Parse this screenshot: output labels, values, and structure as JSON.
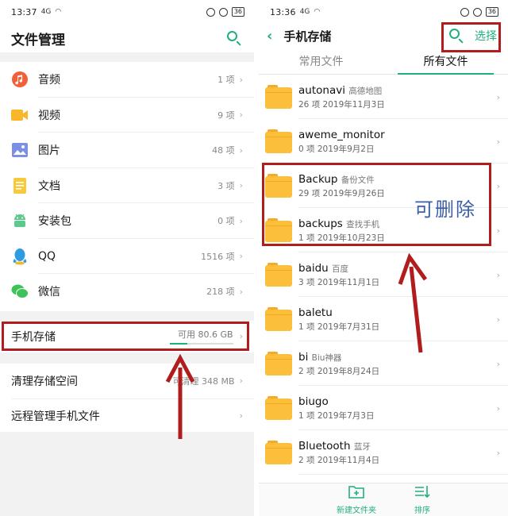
{
  "left": {
    "status": {
      "time": "13:37",
      "signal": "4G",
      "battery": "36"
    },
    "title": "文件管理",
    "categories": [
      {
        "label": "音频",
        "count": "1 项",
        "icon": "music-icon",
        "color": "#f2603a"
      },
      {
        "label": "视频",
        "count": "9 项",
        "icon": "video-icon",
        "color": "#f8b62a"
      },
      {
        "label": "图片",
        "count": "48 项",
        "icon": "image-icon",
        "color": "#7c8fe6"
      },
      {
        "label": "文档",
        "count": "3 项",
        "icon": "document-icon",
        "color": "#f9c93a"
      },
      {
        "label": "安装包",
        "count": "0 项",
        "icon": "android-icon",
        "color": "#5fc98b"
      },
      {
        "label": "QQ",
        "count": "1516 项",
        "icon": "qq-icon",
        "color": "#2f9be0"
      },
      {
        "label": "微信",
        "count": "218 项",
        "icon": "wechat-icon",
        "color": "#3ec35c"
      }
    ],
    "storage": {
      "label": "手机存储",
      "free": "可用 80.6 GB",
      "used_fraction": 0.28
    },
    "clean": {
      "label": "清理存储空间",
      "sub": "可清理 348 MB"
    },
    "remote": {
      "label": "远程管理手机文件"
    }
  },
  "right": {
    "status": {
      "time": "13:36",
      "signal": "4G",
      "battery": "36"
    },
    "title": "手机存储",
    "select_label": "选择",
    "tabs": [
      {
        "label": "常用文件",
        "active": false
      },
      {
        "label": "所有文件",
        "active": true
      }
    ],
    "files": [
      {
        "name": "autonavi",
        "tag": "高德地图",
        "meta": "26 项  2019年11月3日"
      },
      {
        "name": "aweme_monitor",
        "tag": "",
        "meta": "0 项  2019年9月2日"
      },
      {
        "name": "Backup",
        "tag": "备份文件",
        "meta": "29 项  2019年9月26日"
      },
      {
        "name": "backups",
        "tag": "查找手机",
        "meta": "1 项  2019年10月23日"
      },
      {
        "name": "baidu",
        "tag": "百度",
        "meta": "3 项  2019年11月1日"
      },
      {
        "name": "baletu",
        "tag": "",
        "meta": "1 项  2019年7月31日"
      },
      {
        "name": "bi",
        "tag": "Biu神器",
        "meta": "2 项  2019年8月24日"
      },
      {
        "name": "biugo",
        "tag": "",
        "meta": "1 项  2019年7月3日"
      },
      {
        "name": "Bluetooth",
        "tag": "蓝牙",
        "meta": "2 项  2019年11月4日"
      }
    ],
    "bottom": {
      "new_folder": "新建文件夹",
      "sort": "排序"
    },
    "annotation": "可删除"
  },
  "colors": {
    "accent": "#21b07b",
    "annotation_red": "#b11c1c",
    "folder": "#fbbf3c"
  }
}
